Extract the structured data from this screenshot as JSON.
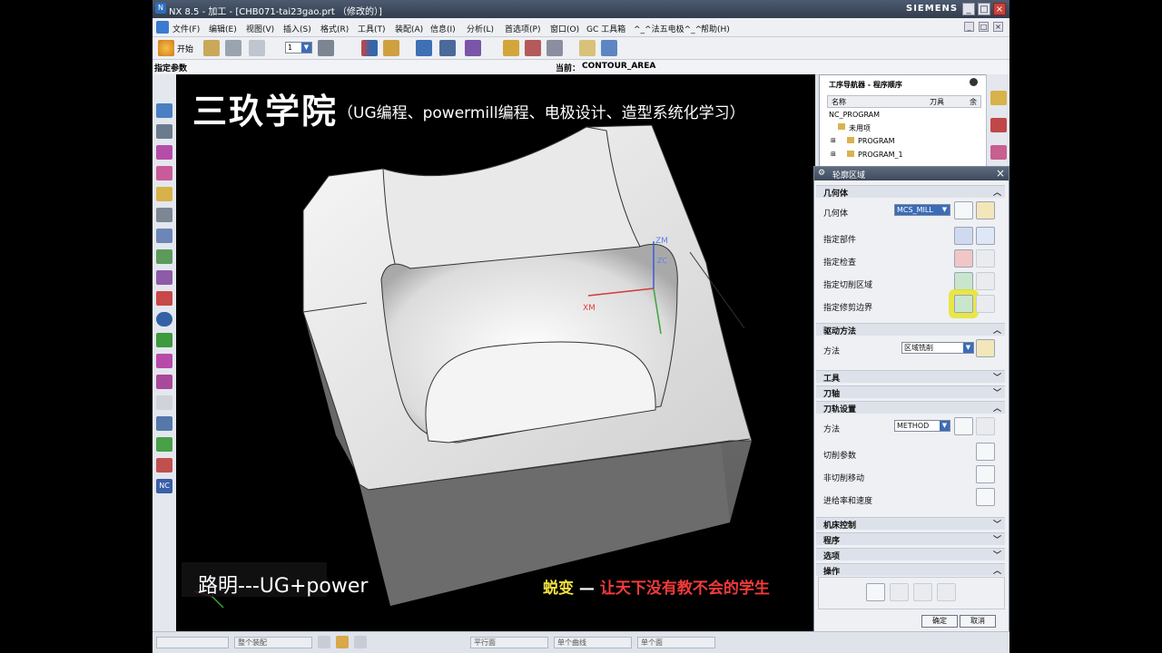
{
  "window": {
    "title": "NX 8.5 - 加工 - [CHB071-tai23gao.prt （修改的）]",
    "brand": "SIEMENS",
    "controls": [
      "_",
      "□",
      "×"
    ]
  },
  "menu": {
    "start": "开始",
    "items": [
      "文件(F)",
      "编辑(E)",
      "视图(V)",
      "插入(S)",
      "格式(R)",
      "工具(T)",
      "装配(A)",
      "信息(I)",
      "分析(L)",
      "首选项(P)",
      "窗口(O)",
      "GC 工具箱",
      "^_^法五电极^_^",
      "帮助(H)"
    ]
  },
  "command_bar": {
    "left": "指定参数",
    "current_label": "当前：",
    "current_value": "CONTOUR_AREA"
  },
  "viewport": {
    "watermark_title": "三玖学院",
    "watermark_subtitle": "（UG编程、powermill编程、电极设计、造型系统化学习）",
    "caption": "路明---UG+power",
    "slogan_a": "蜕变",
    "slogan_dash": "—",
    "slogan_b": "让天下没有教不会的学生",
    "axis_zm": "ZM",
    "axis_zc": "ZC",
    "axis_xm": "XM"
  },
  "navigator": {
    "title": "工序导航器 - 程序顺序",
    "columns": [
      "名称",
      "刀具",
      "余"
    ],
    "rows": [
      "NC_PROGRAM",
      "未用项",
      "PROGRAM",
      "PROGRAM_1"
    ]
  },
  "dialog": {
    "title": "轮廓区域",
    "sections": {
      "geometry": "几何体",
      "drive": "驱动方法",
      "tool": "工具",
      "axis": "刀轴",
      "path": "刀轨设置",
      "machine": "机床控制",
      "program": "程序",
      "options": "选项",
      "actions": "操作"
    },
    "geometry_rows": {
      "geometry_label": "几何体",
      "geometry_value": "MCS_MILL",
      "part": "指定部件",
      "check": "指定检查",
      "cut_area": "指定切削区域",
      "trim": "指定修剪边界"
    },
    "drive_rows": {
      "method_label": "方法",
      "method_value": "区域铣削"
    },
    "path_rows": {
      "method_label": "方法",
      "method_value": "METHOD",
      "cut_params": "切削参数",
      "non_cut": "非切削移动",
      "feeds": "进给率和速度"
    },
    "ok": "确定",
    "cancel": "取消"
  },
  "status": {
    "filter": "整个装配",
    "plane": "平行面",
    "curve": "单个曲线",
    "face": "单个面"
  }
}
